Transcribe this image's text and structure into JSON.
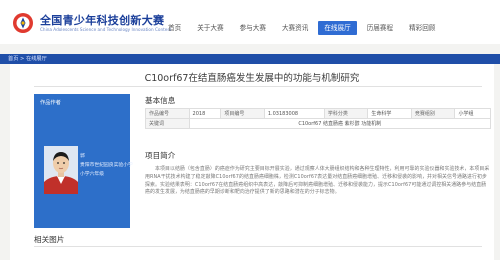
{
  "brand": {
    "title": "全国青少年科技创新大赛",
    "subtitle": "China Adolescents Science and Technology Innovation Contest"
  },
  "nav": {
    "items": [
      "首页",
      "关于大赛",
      "参与大赛",
      "大赛资讯",
      "在线展厅",
      "历届赛程",
      "精彩回顾"
    ],
    "active_index": 4
  },
  "breadcrumb": "首页 > 在线展厅",
  "project": {
    "title": "C10orf67在结直肠癌发生发展中的功能与机制研究"
  },
  "student": {
    "label": "作品作者",
    "name": "郭",
    "school": "贵阳市世纪园良实验小学",
    "grade": "小学六年级"
  },
  "basic_info": {
    "heading": "基本信息",
    "rows": [
      [
        "作品编号",
        "2018",
        "项目编号",
        "1.03183008",
        "学科分类",
        "生命科学",
        "竞赛组别",
        "小学组"
      ],
      [
        "关键词",
        "C10orf67 结直肠癌 紫杉醇 功能机制"
      ]
    ]
  },
  "intro": {
    "heading": "项目简介",
    "text": "本项目以结肠（包含直肠）的癌症作为研究主要目标开展实验，通过观察人体大肠组织结构和各种生理特性，利用可靠的实验仪器和实验技术，本项目采用RNA干扰技术构建了稳定敲降C10orf67的结直肠癌细胞株，检测C10orf67表达量对结直肠癌细胞增殖、迁移和侵袭的影响，并对相关信号通路进行初步探索。实验结果表明：C10orf67在结直肠癌组织中高表达，敲降后可抑制癌细胞增殖、迁移和侵袭能力，提示C10orf67可能通过调控相关通路参与结直肠癌的发生发展，为结直肠癌的早期诊断和靶向治疗提供了新的思路和潜在的分子标志物。"
  },
  "related": {
    "heading": "相关图片"
  },
  "colors": {
    "brand_blue": "#1b3f9a",
    "nav_active": "#2f6cd3",
    "crumb_bar": "#1f4ea8",
    "student_panel": "#2d6fc9"
  },
  "icons": {
    "logo": "contest-logo-icon"
  }
}
